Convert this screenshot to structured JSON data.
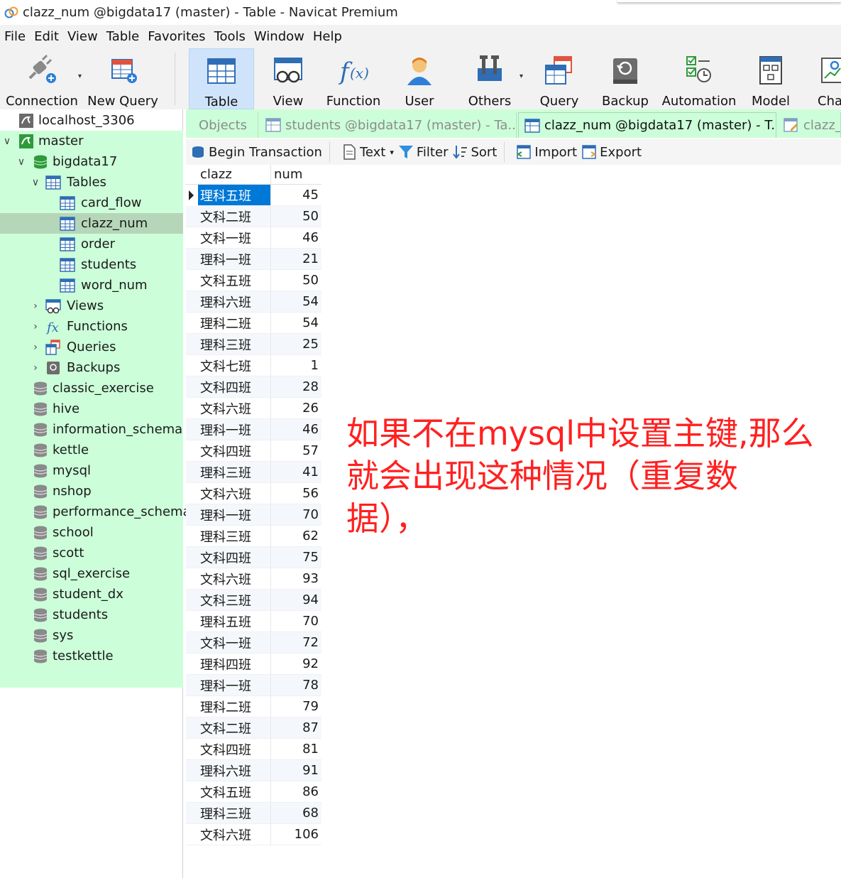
{
  "window": {
    "title": "clazz_num @bigdata17 (master) - Table - Navicat Premium"
  },
  "menu": [
    "File",
    "Edit",
    "View",
    "Table",
    "Favorites",
    "Tools",
    "Window",
    "Help"
  ],
  "toolbar": {
    "connection": "Connection",
    "new_query": "New Query",
    "table": "Table",
    "view": "View",
    "function": "Function",
    "user": "User",
    "others": "Others",
    "query": "Query",
    "backup": "Backup",
    "automation": "Automation",
    "model": "Model",
    "chart": "Cha"
  },
  "navigator": {
    "connection": "localhost_3306",
    "master": "master",
    "database": "bigdata17",
    "tables_folder": "Tables",
    "tables": [
      "card_flow",
      "clazz_num",
      "order",
      "students",
      "word_num"
    ],
    "views": "Views",
    "functions": "Functions",
    "queries": "Queries",
    "backups": "Backups",
    "other_databases": [
      "classic_exercise",
      "hive",
      "information_schema",
      "kettle",
      "mysql",
      "nshop",
      "performance_schema",
      "school",
      "scott",
      "sql_exercise",
      "student_dx",
      "students",
      "sys",
      "testkettle"
    ]
  },
  "tabs": {
    "objects": "Objects",
    "students": "students @bigdata17 (master) - Ta...",
    "clazz_num": "clazz_num @bigdata17 (master) - T...",
    "clazz_query": "clazz_n"
  },
  "object_toolbar": {
    "begin_transaction": "Begin Transaction",
    "text": "Text",
    "filter": "Filter",
    "sort": "Sort",
    "import": "Import",
    "export": "Export"
  },
  "grid": {
    "columns": [
      "clazz",
      "num"
    ],
    "rows": [
      [
        "理科五班",
        "45"
      ],
      [
        "文科二班",
        "50"
      ],
      [
        "文科一班",
        "46"
      ],
      [
        "理科一班",
        "21"
      ],
      [
        "文科五班",
        "50"
      ],
      [
        "理科六班",
        "54"
      ],
      [
        "理科二班",
        "54"
      ],
      [
        "理科三班",
        "25"
      ],
      [
        "文科七班",
        "1"
      ],
      [
        "文科四班",
        "28"
      ],
      [
        "文科六班",
        "26"
      ],
      [
        "理科一班",
        "46"
      ],
      [
        "文科四班",
        "57"
      ],
      [
        "理科三班",
        "41"
      ],
      [
        "文科六班",
        "56"
      ],
      [
        "理科一班",
        "70"
      ],
      [
        "理科三班",
        "62"
      ],
      [
        "文科四班",
        "75"
      ],
      [
        "文科六班",
        "93"
      ],
      [
        "文科三班",
        "94"
      ],
      [
        "理科五班",
        "70"
      ],
      [
        "文科一班",
        "72"
      ],
      [
        "理科四班",
        "92"
      ],
      [
        "理科一班",
        "78"
      ],
      [
        "理科二班",
        "79"
      ],
      [
        "文科二班",
        "87"
      ],
      [
        "文科四班",
        "81"
      ],
      [
        "理科六班",
        "91"
      ],
      [
        "文科五班",
        "86"
      ],
      [
        "理科三班",
        "68"
      ],
      [
        "文科六班",
        "106"
      ]
    ]
  },
  "annotation": "如果不在mysql中设置主键,那么就会出现这种情况（重复数据），"
}
